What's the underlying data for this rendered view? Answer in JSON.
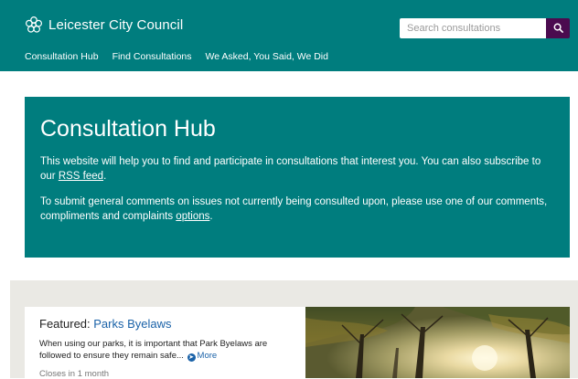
{
  "header": {
    "site_name": "Leicester City Council",
    "logo_icon": "flower-logo-icon",
    "search": {
      "placeholder": "Search consultations",
      "icon": "search-icon"
    },
    "nav": [
      {
        "label": "Consultation Hub"
      },
      {
        "label": "Find Consultations"
      },
      {
        "label": "We Asked, You Said, We Did"
      }
    ]
  },
  "hero": {
    "title": "Consultation Hub",
    "para1_text": "This website will help you to find and participate in consultations that interest you. You can also subscribe to our ",
    "para1_link": "RSS feed",
    "para1_end": ".",
    "para2_text": "To submit general comments on issues not currently being consulted upon, please use one of our comments, compliments and complaints ",
    "para2_link": "options",
    "para2_end": "."
  },
  "featured": {
    "prefix": "Featured: ",
    "title": "Parks Byelaws",
    "description": "When using our parks, it is important that Park Byelaws are followed to ensure they remain safe...",
    "more_label": "More",
    "closes": "Closes in 1 month"
  },
  "colors": {
    "brand_teal": "#007d7e",
    "search_button": "#4b0b4f",
    "link_blue": "#1a62a8",
    "featured_background": "#eae9e4"
  }
}
